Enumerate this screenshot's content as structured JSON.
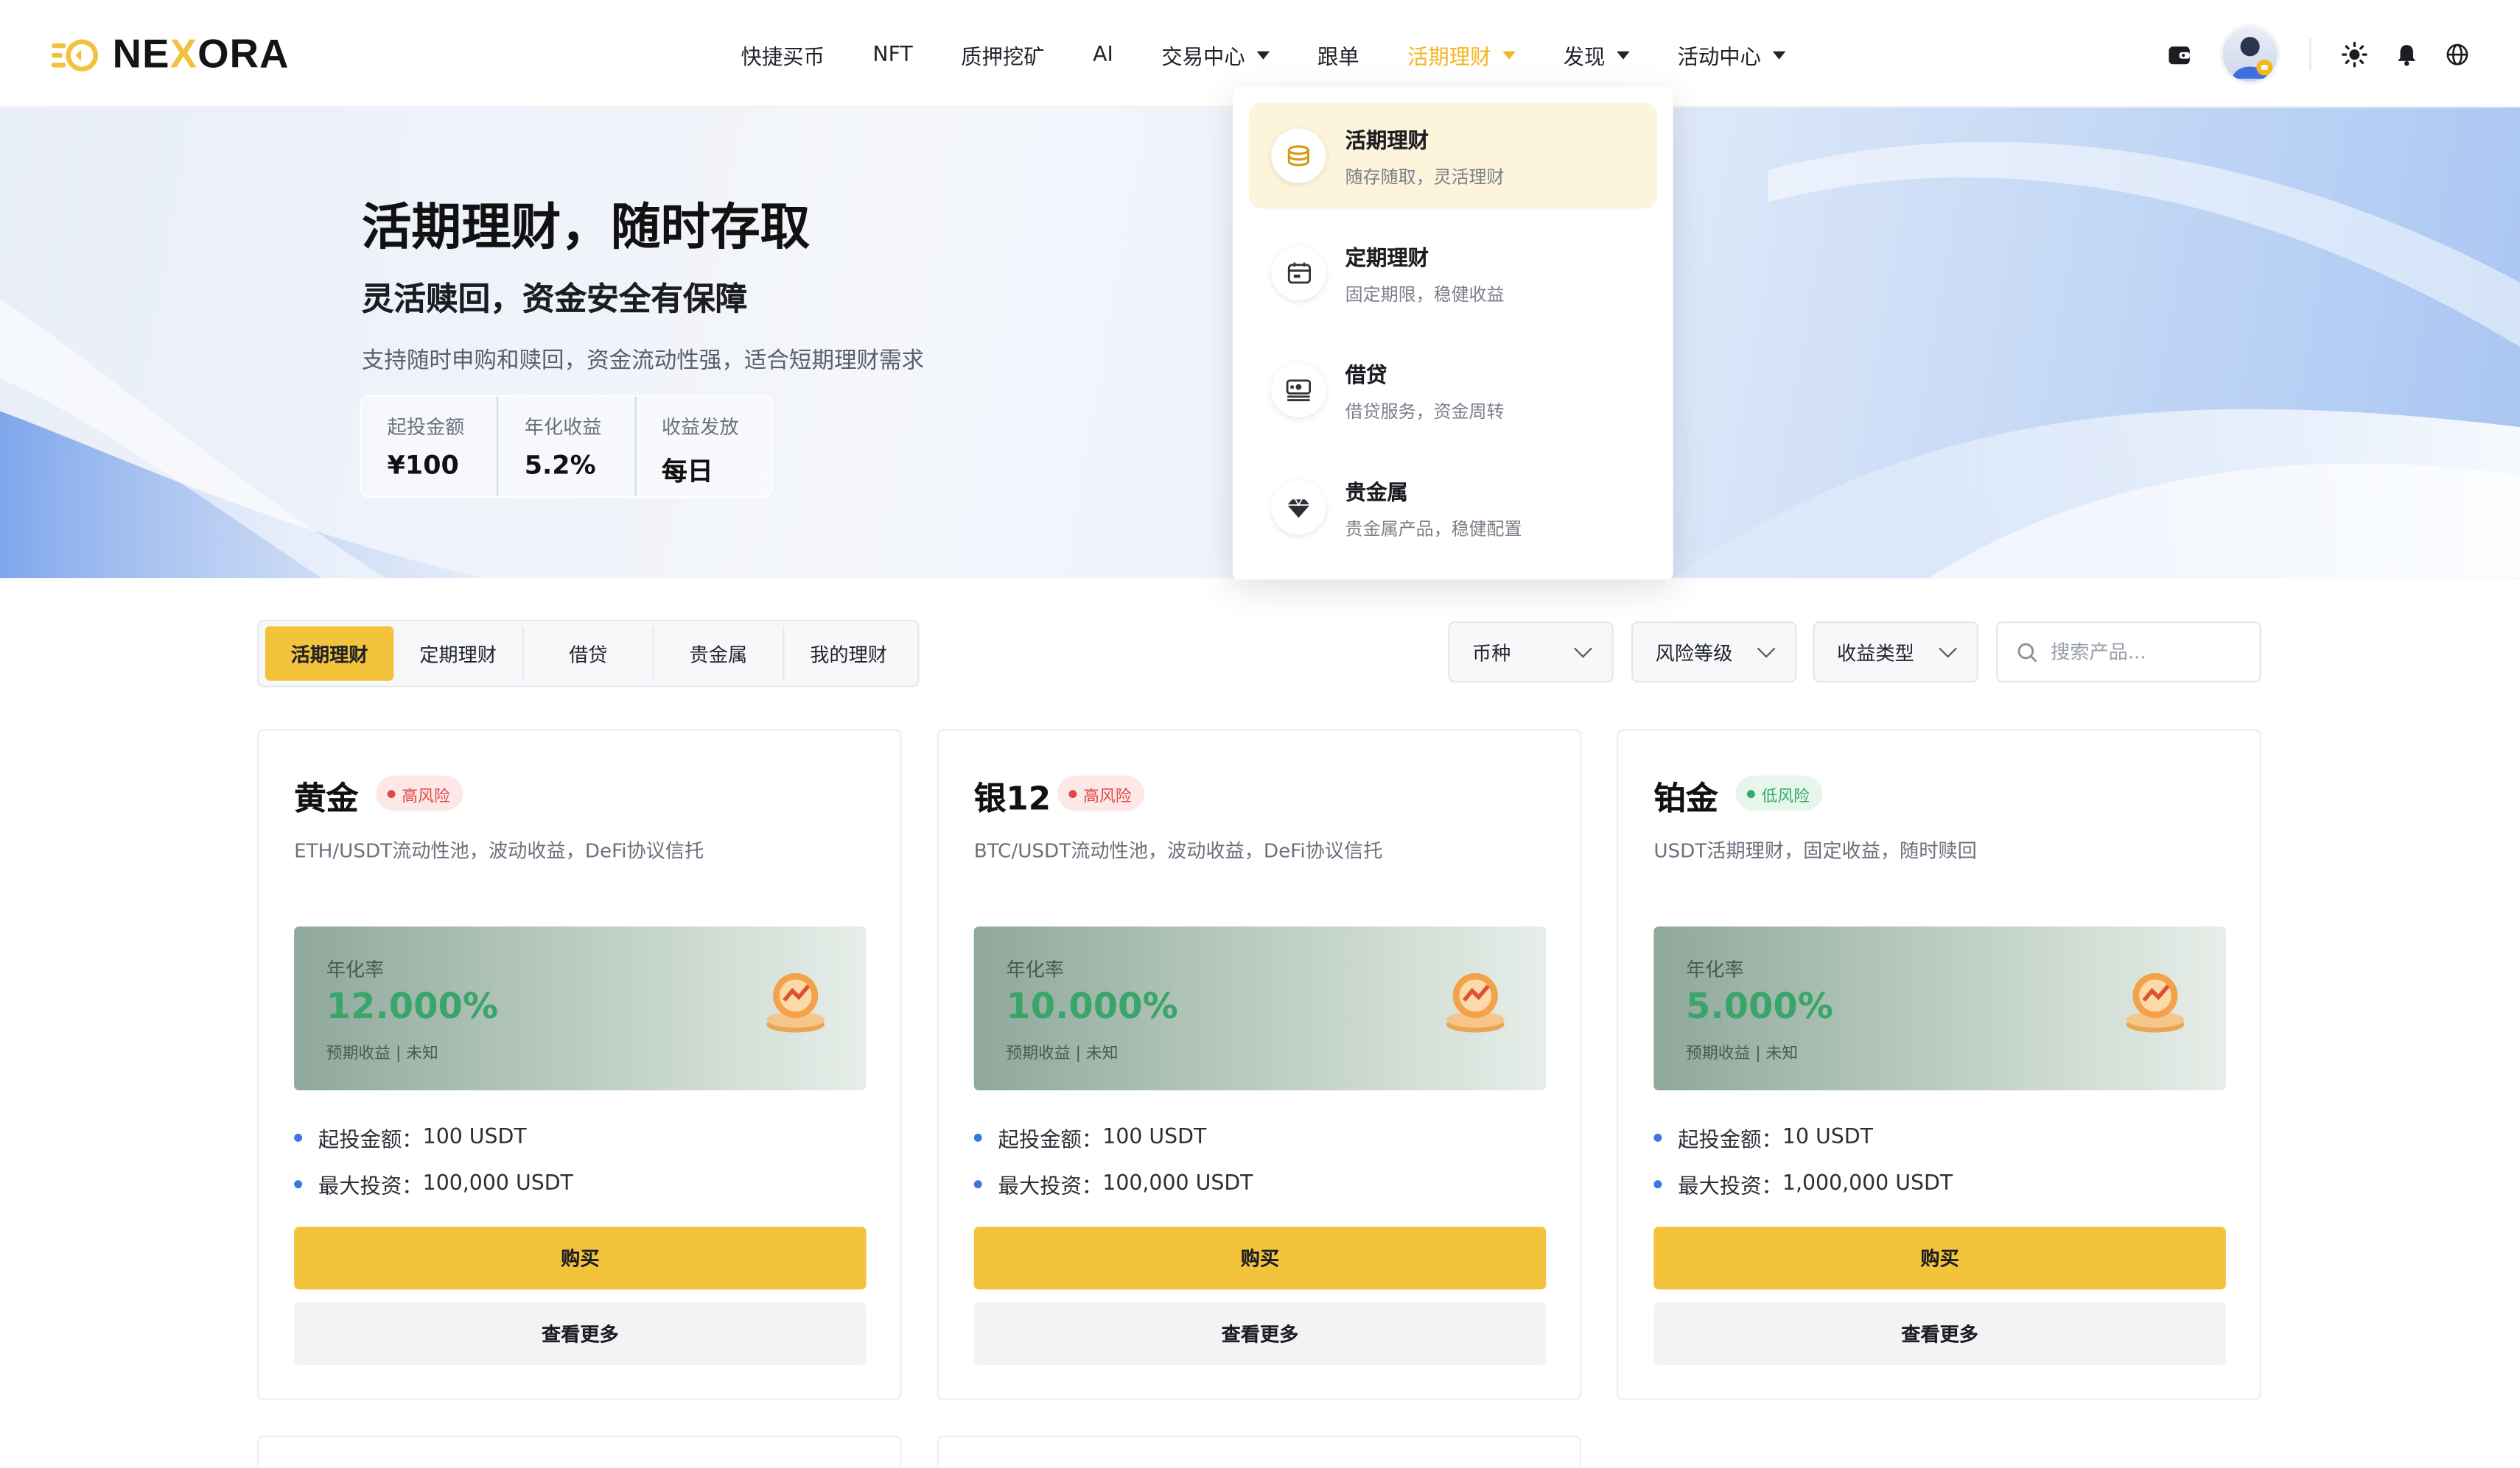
{
  "brand": {
    "name_a": "NE",
    "name_x": "X",
    "name_b": "ORA"
  },
  "nav": [
    {
      "label": "快捷买币",
      "dropdown": false,
      "active": false
    },
    {
      "label": "NFT",
      "dropdown": false,
      "active": false
    },
    {
      "label": "质押挖矿",
      "dropdown": false,
      "active": false
    },
    {
      "label": "AI",
      "dropdown": false,
      "active": false
    },
    {
      "label": "交易中心",
      "dropdown": true,
      "active": false
    },
    {
      "label": "跟单",
      "dropdown": false,
      "active": false
    },
    {
      "label": "活期理财",
      "dropdown": true,
      "active": true
    },
    {
      "label": "发现",
      "dropdown": true,
      "active": false
    },
    {
      "label": "活动中心",
      "dropdown": true,
      "active": false
    }
  ],
  "banner": {
    "title": "活期理财，随时存取",
    "subtitle": "灵活赎回，资金安全有保障",
    "desc": "支持随时申购和赎回，资金流动性强，适合短期理财需求",
    "stats": [
      {
        "label": "起投金额",
        "value": "¥100"
      },
      {
        "label": "年化收益",
        "value": "5.2%"
      },
      {
        "label": "收益发放",
        "value": "每日"
      }
    ]
  },
  "dropdown": [
    {
      "title": "活期理财",
      "desc": "随存随取，灵活理财",
      "icon": "coins-icon"
    },
    {
      "title": "定期理财",
      "desc": "固定期限，稳健收益",
      "icon": "calendar-icon"
    },
    {
      "title": "借贷",
      "desc": "借贷服务，资金周转",
      "icon": "loan-icon"
    },
    {
      "title": "贵金属",
      "desc": "贵金属产品，稳健配置",
      "icon": "gem-icon"
    }
  ],
  "tabs": [
    "活期理财",
    "定期理财",
    "借贷",
    "贵金属",
    "我的理财"
  ],
  "filters": {
    "coin": "币种",
    "risk": "风险等级",
    "yield_type": "收益类型",
    "search_placeholder": "搜索产品..."
  },
  "products": [
    {
      "name": "黄金",
      "risk": "高风险",
      "risk_level": "high",
      "desc": "ETH/USDT流动性池，波动收益，DeFi协议信托",
      "rate_label": "年化率",
      "rate": "12.000%",
      "rate_foot": "预期收益 | 未知",
      "min_label": "起投金额：",
      "min": "100 USDT",
      "max_label": "最大投资：",
      "max": "100,000 USDT",
      "buy": "购买",
      "more": "查看更多"
    },
    {
      "name": "银12",
      "risk": "高风险",
      "risk_level": "high",
      "desc": "BTC/USDT流动性池，波动收益，DeFi协议信托",
      "rate_label": "年化率",
      "rate": "10.000%",
      "rate_foot": "预期收益 | 未知",
      "min_label": "起投金额：",
      "min": "100 USDT",
      "max_label": "最大投资：",
      "max": "100,000 USDT",
      "buy": "购买",
      "more": "查看更多"
    },
    {
      "name": "铂金",
      "risk": "低风险",
      "risk_level": "low",
      "desc": "USDT活期理财，固定收益，随时赎回",
      "rate_label": "年化率",
      "rate": "5.000%",
      "rate_foot": "预期收益 | 未知",
      "min_label": "起投金额：",
      "min": "10 USDT",
      "max_label": "最大投资：",
      "max": "1,000,000 USDT",
      "buy": "购买",
      "more": "查看更多"
    }
  ],
  "colors": {
    "accent": "#f4c33c",
    "rate_green": "#3aa569",
    "risk_high": "#e04848",
    "risk_low": "#36a86a"
  }
}
